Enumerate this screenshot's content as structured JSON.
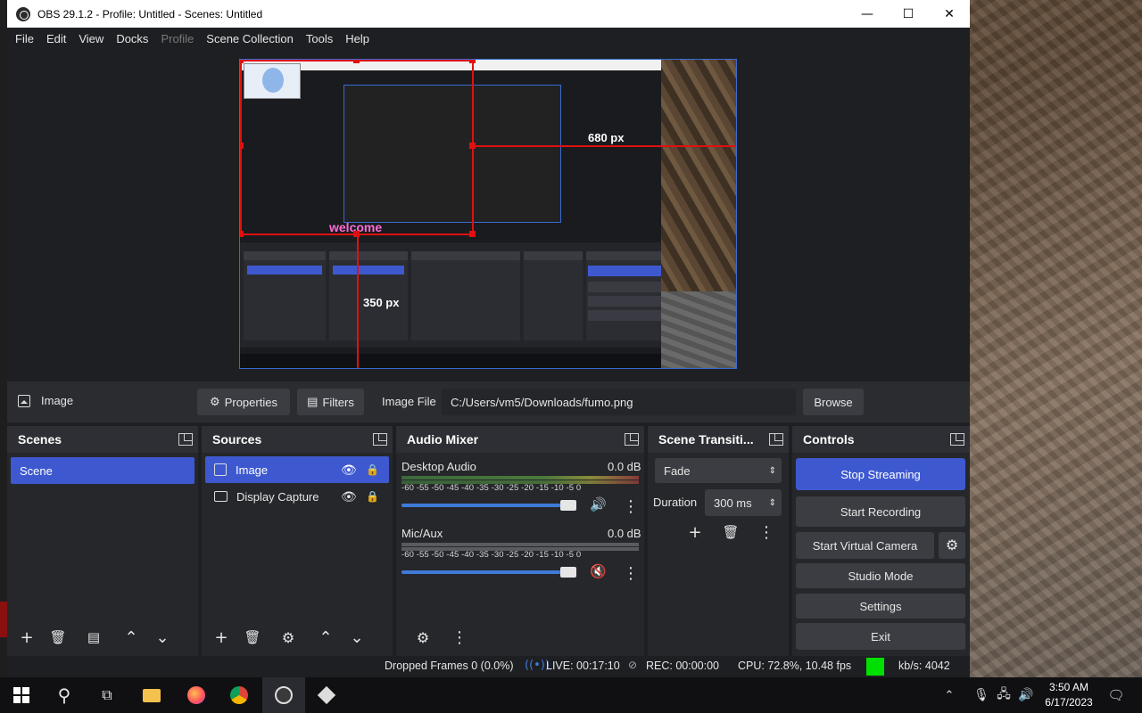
{
  "window": {
    "title": "OBS 29.1.2 - Profile: Untitled - Scenes: Untitled",
    "minimize": "—",
    "maximize": "☐",
    "close": "✕"
  },
  "menu": [
    "File",
    "Edit",
    "View",
    "Docks",
    "Profile",
    "Scene Collection",
    "Tools",
    "Help"
  ],
  "preview": {
    "width_label": "680 px",
    "height_label": "350 px",
    "welcome_text": "welcome",
    "selection_color": "#e01010"
  },
  "source_toolbar": {
    "source_name": "Image",
    "properties_label": "Properties",
    "filters_label": "Filters",
    "image_file_label": "Image File",
    "image_file_value": "C:/Users/vm5/Downloads/fumo.png",
    "browse_label": "Browse"
  },
  "scenes": {
    "title": "Scenes",
    "items": [
      {
        "label": "Scene",
        "selected": true
      }
    ]
  },
  "sources": {
    "title": "Sources",
    "items": [
      {
        "label": "Image",
        "icon": "image-icon",
        "selected": true
      },
      {
        "label": "Display Capture",
        "icon": "monitor-icon",
        "selected": false
      }
    ]
  },
  "audio_mixer": {
    "title": "Audio Mixer",
    "channels": [
      {
        "name": "Desktop Audio",
        "level": "0.0 dB",
        "muted": false,
        "volume": 0.95
      },
      {
        "name": "Mic/Aux",
        "level": "0.0 dB",
        "muted": true,
        "volume": 0.95
      }
    ],
    "scale": "-60 -55 -50 -45 -40 -35 -30 -25 -20 -15 -10 -5 0"
  },
  "scene_transitions": {
    "title": "Scene Transiti...",
    "transition": "Fade",
    "duration_label": "Duration",
    "duration_value": "300 ms"
  },
  "controls": {
    "title": "Controls",
    "stop_streaming": "Stop Streaming",
    "start_recording": "Start Recording",
    "start_virtual_camera": "Start Virtual Camera",
    "studio_mode": "Studio Mode",
    "settings": "Settings",
    "exit": "Exit",
    "accent": "#3e59d0"
  },
  "status": {
    "dropped_frames": "Dropped Frames 0 (0.0%)",
    "live": "LIVE: 00:17:10",
    "rec": "REC: 00:00:00",
    "cpu": "CPU: 72.8%, 10.48 fps",
    "bitrate": "kb/s: 4042",
    "health_color": "#00e000"
  },
  "taskbar": {
    "time": "3:50 AM",
    "date": "6/17/2023"
  }
}
